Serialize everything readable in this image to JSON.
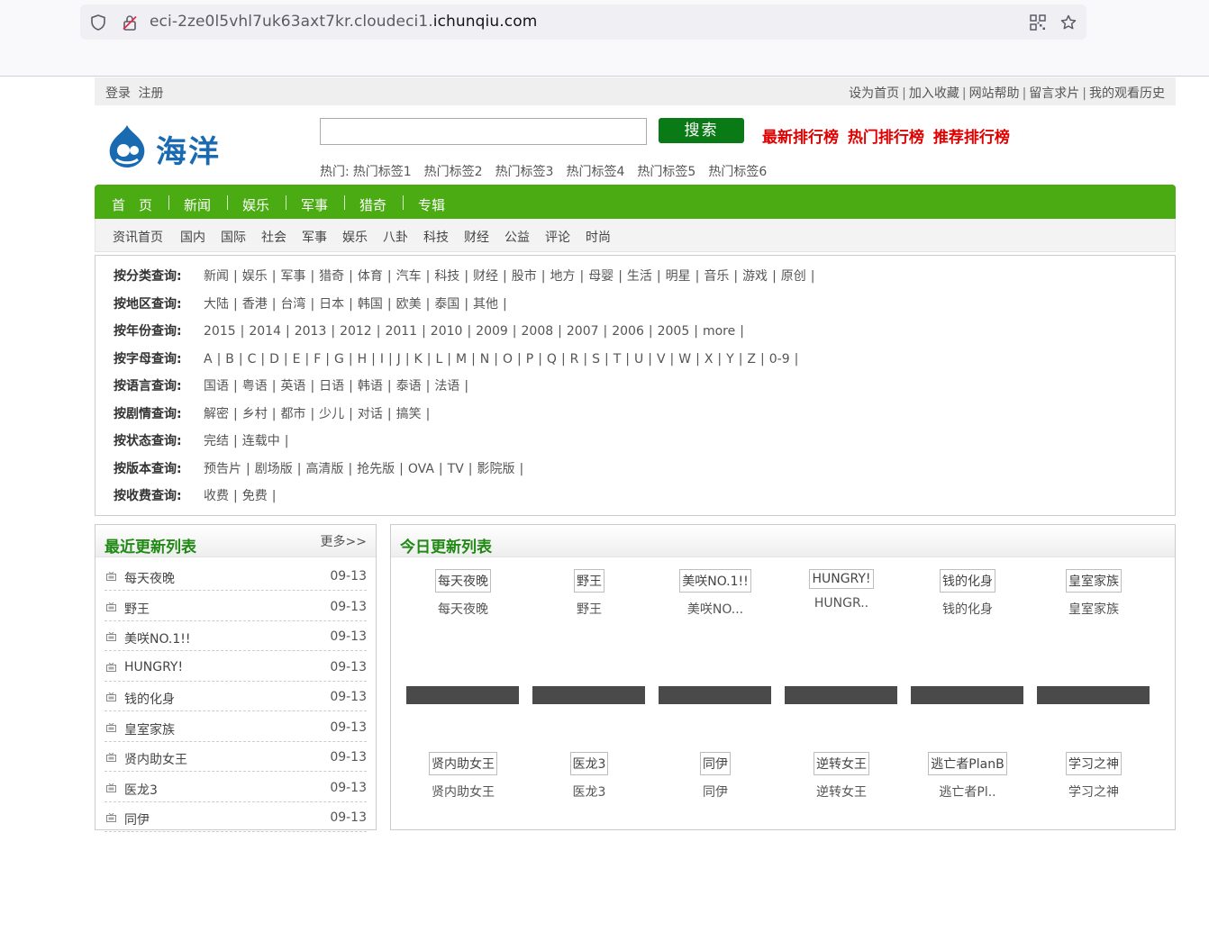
{
  "browser": {
    "url_prefix": "eci-2ze0l5vhl7uk63axt7kr.cloudeci1.",
    "url_domain": "ichunqiu.com"
  },
  "topbar": {
    "left": [
      "登录",
      "注册"
    ],
    "right": [
      "设为首页",
      "加入收藏",
      "网站帮助",
      "留言求片",
      "我的观看历史"
    ]
  },
  "header": {
    "logo_text": "海洋",
    "search_placeholder": "",
    "search_button": "搜索",
    "rank_links": [
      "最新排行榜",
      "热门排行榜",
      "推荐排行榜"
    ],
    "hot_label": "热门:",
    "hot_tags": [
      "热门标签1",
      "热门标签2",
      "热门标签3",
      "热门标签4",
      "热门标签5",
      "热门标签6"
    ]
  },
  "main_nav": [
    "首　页",
    "新闻",
    "娱乐",
    "军事",
    "猎奇",
    "专辑"
  ],
  "sub_nav": [
    "资讯首页",
    "国内",
    "国际",
    "社会",
    "军事",
    "娱乐",
    "八卦",
    "科技",
    "财经",
    "公益",
    "评论",
    "时尚"
  ],
  "filters": [
    {
      "label": "按分类查询:",
      "options": [
        "新闻",
        "娱乐",
        "军事",
        "猎奇",
        "体育",
        "汽车",
        "科技",
        "财经",
        "股市",
        "地方",
        "母婴",
        "生活",
        "明星",
        "音乐",
        "游戏",
        "原创"
      ]
    },
    {
      "label": "按地区查询:",
      "options": [
        "大陆",
        "香港",
        "台湾",
        "日本",
        "韩国",
        "欧美",
        "泰国",
        "其他"
      ]
    },
    {
      "label": "按年份查询:",
      "options": [
        "2015",
        "2014",
        "2013",
        "2012",
        "2011",
        "2010",
        "2009",
        "2008",
        "2007",
        "2006",
        "2005",
        "more"
      ]
    },
    {
      "label": "按字母查询:",
      "options": [
        "A",
        "B",
        "C",
        "D",
        "E",
        "F",
        "G",
        "H",
        "I",
        "J",
        "K",
        "L",
        "M",
        "N",
        "O",
        "P",
        "Q",
        "R",
        "S",
        "T",
        "U",
        "V",
        "W",
        "X",
        "Y",
        "Z",
        "0-9"
      ]
    },
    {
      "label": "按语言查询:",
      "options": [
        "国语",
        "粤语",
        "英语",
        "日语",
        "韩语",
        "泰语",
        "法语"
      ]
    },
    {
      "label": "按剧情查询:",
      "options": [
        "解密",
        "乡村",
        "都市",
        "少儿",
        "对话",
        "搞笑"
      ]
    },
    {
      "label": "按状态查询:",
      "options": [
        "完结",
        "连载中"
      ]
    },
    {
      "label": "按版本查询:",
      "options": [
        "预告片",
        "剧场版",
        "高清版",
        "抢先版",
        "OVA",
        "TV",
        "影院版"
      ]
    },
    {
      "label": "按收费查询:",
      "options": [
        "收费",
        "免费"
      ]
    }
  ],
  "recent": {
    "title": "最近更新列表",
    "more": "更多>>",
    "items": [
      {
        "name": "每天夜晚",
        "date": "09-13"
      },
      {
        "name": "野王",
        "date": "09-13"
      },
      {
        "name": "美咲NO.1!!",
        "date": "09-13"
      },
      {
        "name": "HUNGRY!",
        "date": "09-13"
      },
      {
        "name": "钱的化身",
        "date": "09-13"
      },
      {
        "name": "皇室家族",
        "date": "09-13"
      },
      {
        "name": "贤内助女王",
        "date": "09-13"
      },
      {
        "name": "医龙3",
        "date": "09-13"
      },
      {
        "name": "同伊",
        "date": "09-13"
      }
    ]
  },
  "today": {
    "title": "今日更新列表",
    "row1": [
      {
        "name": "每天夜晚",
        "sub": "每天夜晚"
      },
      {
        "name": "野王",
        "sub": "野王"
      },
      {
        "name": "美咲NO.1!!",
        "sub": "美咲NO..."
      },
      {
        "name": "HUNGRY!",
        "sub": "HUNGR.."
      },
      {
        "name": "钱的化身",
        "sub": "钱的化身"
      },
      {
        "name": "皇室家族",
        "sub": "皇室家族"
      }
    ],
    "row2": [
      {
        "name": "贤内助女王",
        "sub": "贤内助女王"
      },
      {
        "name": "医龙3",
        "sub": "医龙3"
      },
      {
        "name": "同伊",
        "sub": "同伊"
      },
      {
        "name": "逆转女王",
        "sub": "逆转女王"
      },
      {
        "name": "逃亡者PlanB",
        "sub": "逃亡者Pl.."
      },
      {
        "name": "学习之神",
        "sub": "学习之神"
      }
    ]
  },
  "colors": {
    "nav_green": "#4aab12",
    "button_green": "#0a7a16",
    "rank_red": "#e00000",
    "title_green": "#208a14"
  }
}
